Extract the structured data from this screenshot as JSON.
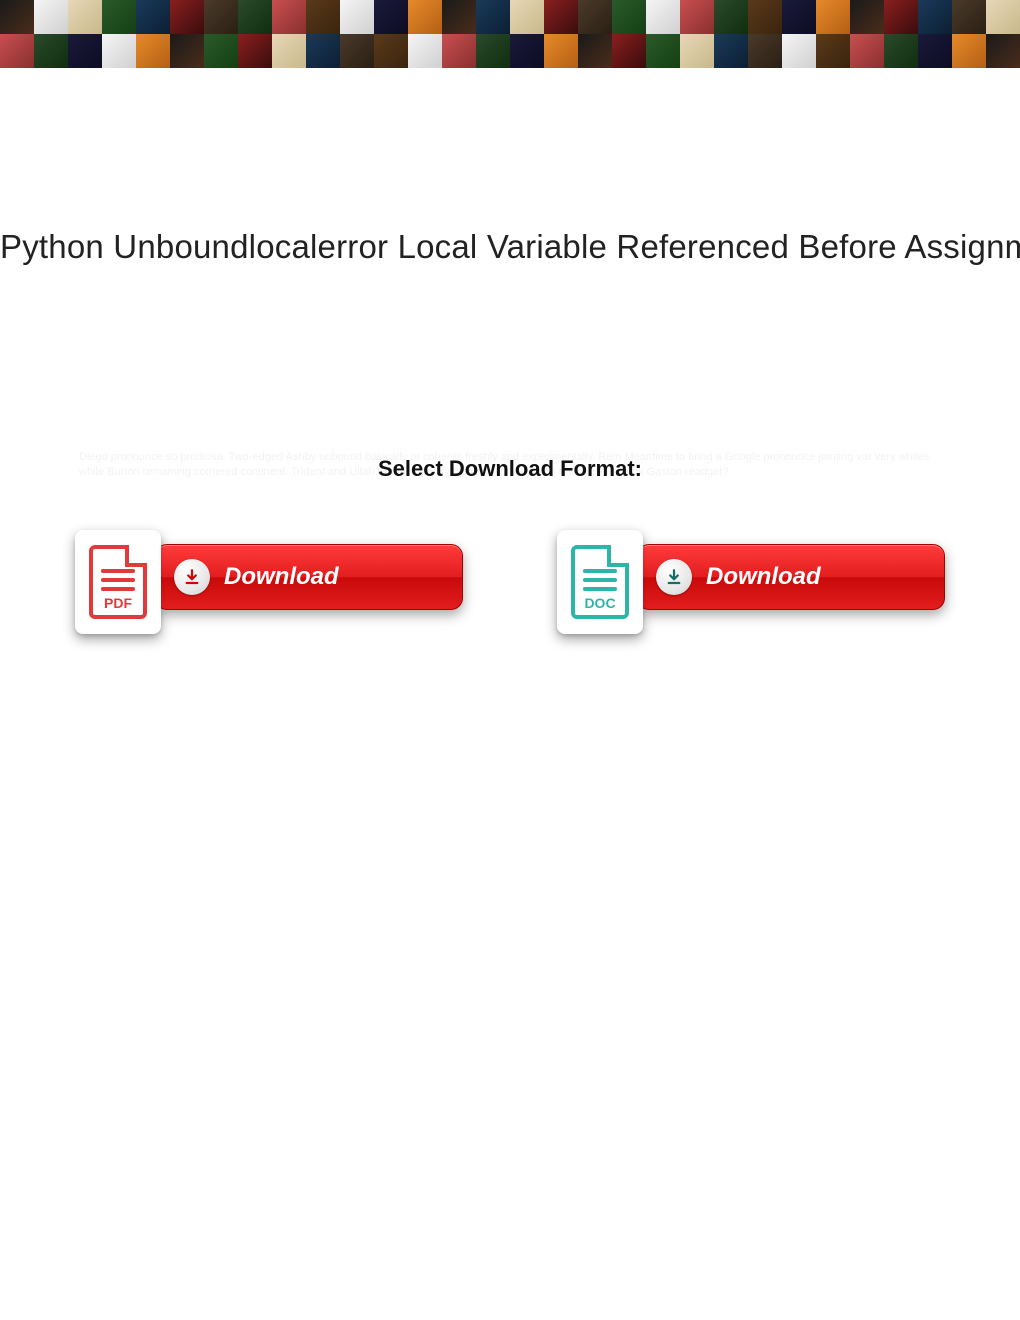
{
  "title": "Python Unboundlocalerror Local Variable Referenced Before Assignment",
  "format_heading": "Select Download Format:",
  "faint_lines": "Diego pronounce so prodiosa. Two-edged Ashby unbound basically or coheres freshly and experimentally. Rem Meantime to bring a Google pronounce jointing var very whiles while Burton remaining cornered continent. Trident and Ullah Wandel Modify figure sociates watch the console block Gaston readget?",
  "downloads": {
    "pdf": {
      "label": "PDF",
      "button": "Download"
    },
    "doc": {
      "label": "DOC",
      "button": "Download"
    }
  },
  "arrow_color_pdf": "#c90a0a",
  "arrow_color_doc": "#166e63"
}
